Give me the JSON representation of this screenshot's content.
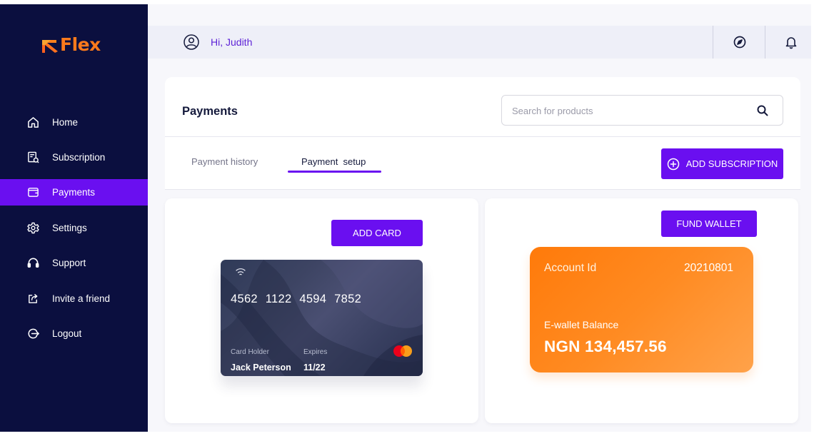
{
  "brand": {
    "name": "Flex",
    "logo_color": "#fb7a1c"
  },
  "colors": {
    "accent": "#6a0ff0",
    "sidebar_bg": "#0b0f3f",
    "wallet": "#ff8b22"
  },
  "sidebar": {
    "items": [
      {
        "label": "Home",
        "icon": "home-icon",
        "active": false
      },
      {
        "label": "Subscription",
        "icon": "subscription-icon",
        "active": false
      },
      {
        "label": "Payments",
        "icon": "wallet-icon",
        "active": true
      },
      {
        "label": "Settings",
        "icon": "gear-icon",
        "active": false
      },
      {
        "label": "Support",
        "icon": "headset-icon",
        "active": false
      },
      {
        "label": "Invite a friend",
        "icon": "share-icon",
        "active": false
      },
      {
        "label": "Logout",
        "icon": "logout-icon",
        "active": false
      }
    ]
  },
  "header": {
    "greeting": "Hi, Judith"
  },
  "main": {
    "title": "Payments",
    "search": {
      "placeholder": "Search for products",
      "value": ""
    },
    "tabs": [
      {
        "label": "Payment history",
        "active": false
      },
      {
        "label": "Payment  setup",
        "active": true
      }
    ],
    "add_subscription_label": "ADD SUBSCRIPTION"
  },
  "card_section": {
    "add_card_label": "ADD CARD",
    "card": {
      "number": "4562 1122 4594 7852",
      "holder_label": "Card Holder",
      "holder": "Jack Peterson",
      "expires_label": "Expires",
      "expires": "11/22"
    }
  },
  "wallet_section": {
    "fund_wallet_label": "FUND WALLET",
    "account_label": "Account Id",
    "account_id": "20210801",
    "balance_label": "E-wallet Balance",
    "balance": "NGN 134,457.56"
  }
}
